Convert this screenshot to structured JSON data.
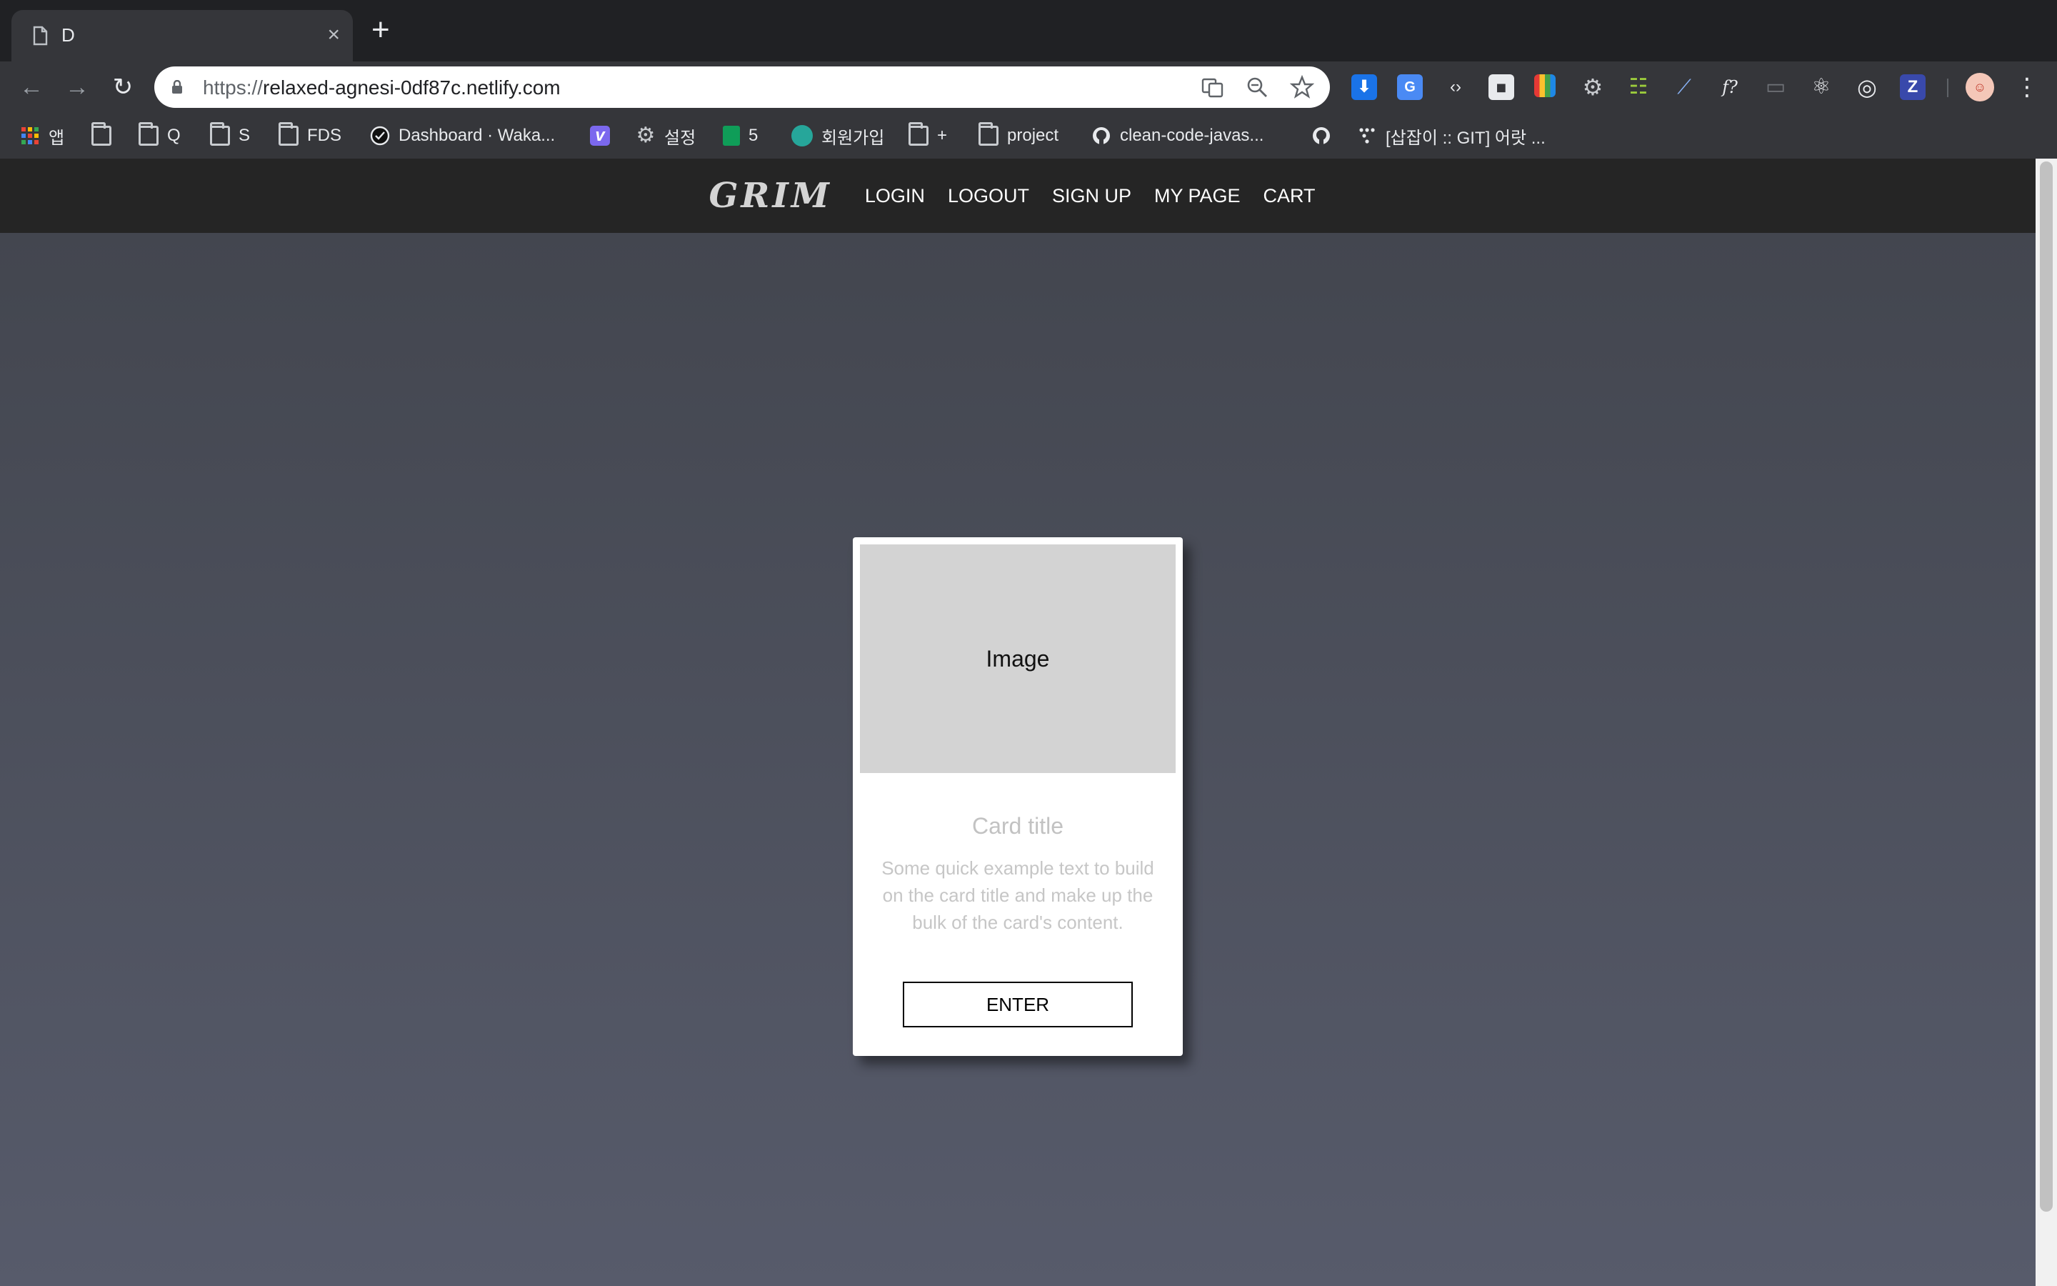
{
  "browser": {
    "tab": {
      "title": "D",
      "close": "×"
    },
    "new_tab": "+",
    "omnibox": {
      "scheme": "https://",
      "host": "relaxed-agnesi-0df87c.netlify.com"
    },
    "nav_icons": {
      "back": "←",
      "forward": "→",
      "reload": "↻"
    },
    "extensions": [
      "download-icon",
      "translate-icon",
      "code-icon",
      "evernote-icon",
      "books-icon",
      "gear-icon",
      "ladder-icon",
      "pen-icon",
      "formula-icon",
      "cast-icon",
      "react-icon",
      "target-icon",
      "z-icon",
      "avatar",
      "menu-icon"
    ],
    "ext_labels": {
      "code": "‹›",
      "formula": "f?",
      "z": "Z",
      "menu": "⋮"
    },
    "bookmarks": [
      {
        "label": "앱",
        "icon": "apps-grid-icon"
      },
      {
        "label": "",
        "icon": "folder-icon"
      },
      {
        "label": "Q",
        "icon": "folder-icon"
      },
      {
        "label": "S",
        "icon": "folder-icon"
      },
      {
        "label": "FDS",
        "icon": "folder-icon"
      },
      {
        "label": "Dashboard · Waka...",
        "icon": "wakatime-icon"
      },
      {
        "label": "",
        "icon": "v-icon"
      },
      {
        "label": "설정",
        "icon": "gear-icon"
      },
      {
        "label": "5",
        "icon": "sheets-icon"
      },
      {
        "label": "회원가입",
        "icon": "globe-icon"
      },
      {
        "label": "+",
        "icon": "folder-icon"
      },
      {
        "label": "project",
        "icon": "folder-icon"
      },
      {
        "label": "clean-code-javas...",
        "icon": "github-icon"
      },
      {
        "label": "",
        "icon": "github-icon"
      },
      {
        "label": "[삽잡이 :: GIT] 어랏 ...",
        "icon": "dots-icon"
      }
    ]
  },
  "site": {
    "brand": "GRIM",
    "nav": [
      "LOGIN",
      "LOGOUT",
      "SIGN UP",
      "MY PAGE",
      "CART"
    ]
  },
  "card": {
    "image_label": "Image",
    "title": "Card title",
    "text": "Some quick example text to build on the card title and make up the bulk of the card's content.",
    "button": "ENTER"
  },
  "colors": {
    "chrome_dark": "#202124",
    "chrome_toolbar": "#35363a",
    "site_nav": "#252525",
    "page_bg_top": "#43464f",
    "page_bg_bottom": "#575b6b",
    "card_image": "#d3d3d3"
  }
}
